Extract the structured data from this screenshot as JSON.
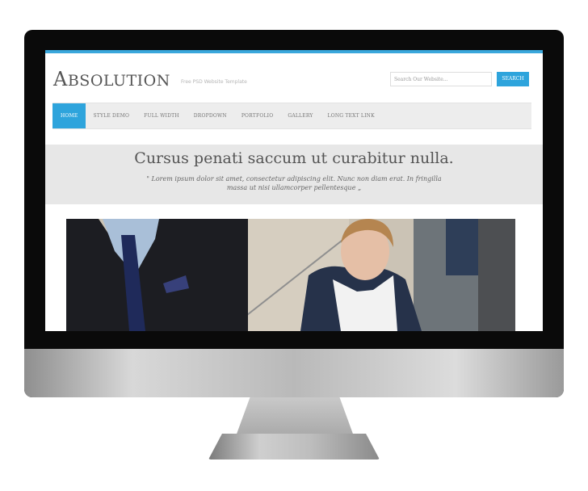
{
  "site": {
    "logo": "Absolution",
    "logo_first": "A",
    "logo_rest": "BSOLUTION",
    "tagline": "Free PSD Website Template"
  },
  "search": {
    "placeholder": "Search Our Website...",
    "button_label": "SEARCH"
  },
  "nav": {
    "items": [
      {
        "label": "HOME",
        "active": true
      },
      {
        "label": "STYLE DEMO"
      },
      {
        "label": "FULL WIDTH"
      },
      {
        "label": "DROPDOWN"
      },
      {
        "label": "PORTFOLIO"
      },
      {
        "label": "GALLERY"
      },
      {
        "label": "LONG TEXT LINK"
      }
    ]
  },
  "banner": {
    "headline": "Cursus penati saccum ut curabitur nulla.",
    "quote": "\" Lorem ipsum dolor sit amet, consectetur adipiscing elit. Nunc non diam erat. In fringilla massa ut nisi ullamcorper pellentesque „"
  },
  "colors": {
    "accent": "#2ea4dc",
    "monitor_bezel": "#0a0a0a",
    "banner_bg": "#e7e7e7"
  },
  "icons": {
    "hero": "business-people-photo"
  }
}
